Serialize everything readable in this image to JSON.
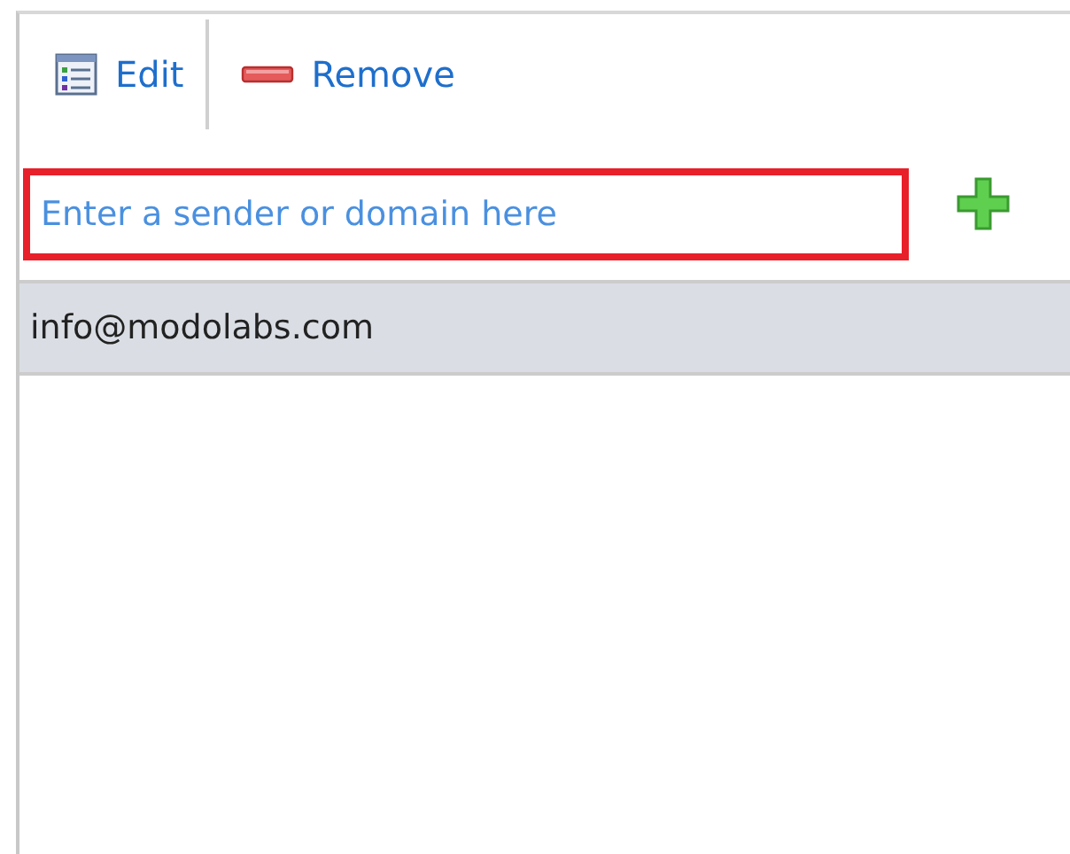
{
  "toolbar": [
    {
      "kind": "edit",
      "label": "Edit"
    },
    {
      "kind": "remove",
      "label": "Remove"
    }
  ],
  "sender_field": {
    "placeholder": "Enter a sender or domain here",
    "highlighted": true
  },
  "senders": [
    {
      "address": "info@modolabs.com",
      "selected": true
    }
  ]
}
